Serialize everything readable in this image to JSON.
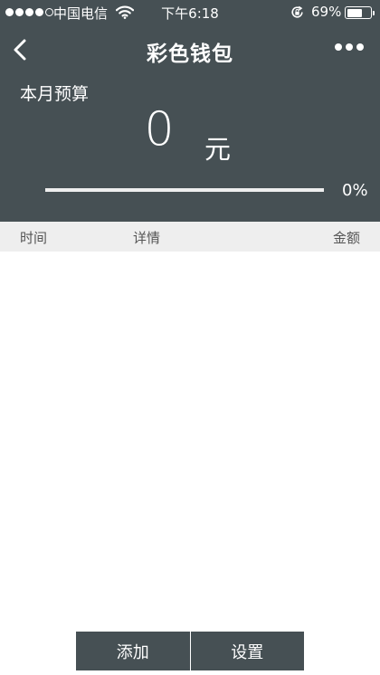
{
  "status_bar": {
    "carrier": "中国电信",
    "time": "下午6:18",
    "battery_percent": "69%",
    "battery_level": 0.69,
    "signal_bars_filled": 4,
    "signal_bars_total": 5
  },
  "nav": {
    "title": "彩色钱包",
    "back_icon": "chevron-left-icon",
    "more_icon": "more-dots-icon"
  },
  "budget": {
    "label": "本月预算",
    "value": "0",
    "unit": "元",
    "progress_percent": "0%",
    "progress_fraction": 0
  },
  "table": {
    "columns": [
      "时间",
      "详情",
      "金额"
    ],
    "rows": []
  },
  "actions": {
    "add_label": "添加",
    "settings_label": "设置"
  },
  "colors": {
    "header_bg": "#465054",
    "table_header_bg": "#eeeeee"
  }
}
